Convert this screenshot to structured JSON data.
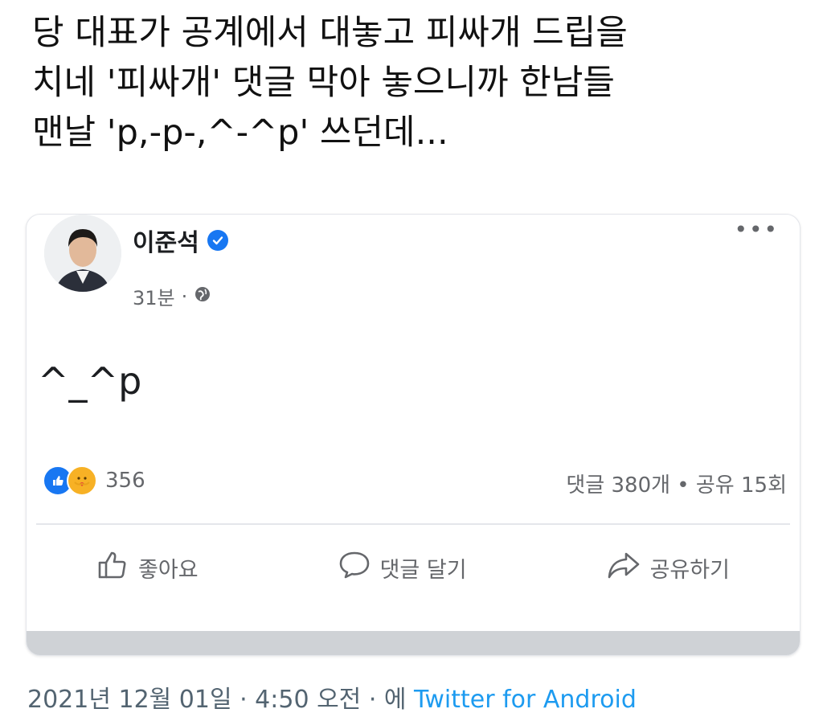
{
  "tweet": {
    "lines": [
      "당 대표가 공계에서 대놓고 피싸개 드립을",
      "치네 '피싸개' 댓글 막아 놓으니까 한남들",
      "맨날 'p,-p-,^-^p' 쓰던데..."
    ],
    "date_text": "2021년 12월 01일 · 4:50 오전 · 에 ",
    "source": "Twitter for Android"
  },
  "post": {
    "author": "이준석",
    "time": "31분",
    "separator": "·",
    "more": "•••",
    "body": "^_^p",
    "reaction_count": "356",
    "stats": "댓글 380개 • 공유 15회",
    "actions": {
      "like": "좋아요",
      "comment": "댓글 달기",
      "share": "공유하기"
    }
  },
  "icons": [
    "verified-badge-icon",
    "globe-icon",
    "more-options-icon",
    "like-reaction-icon",
    "care-reaction-icon",
    "thumbs-up-icon",
    "comment-bubble-icon",
    "share-arrow-icon"
  ],
  "colors": {
    "facebook_blue": "#1877f2",
    "twitter_link": "#1d9bf0",
    "muted_gray": "#65676b",
    "care_yellow": "#f7b125"
  }
}
